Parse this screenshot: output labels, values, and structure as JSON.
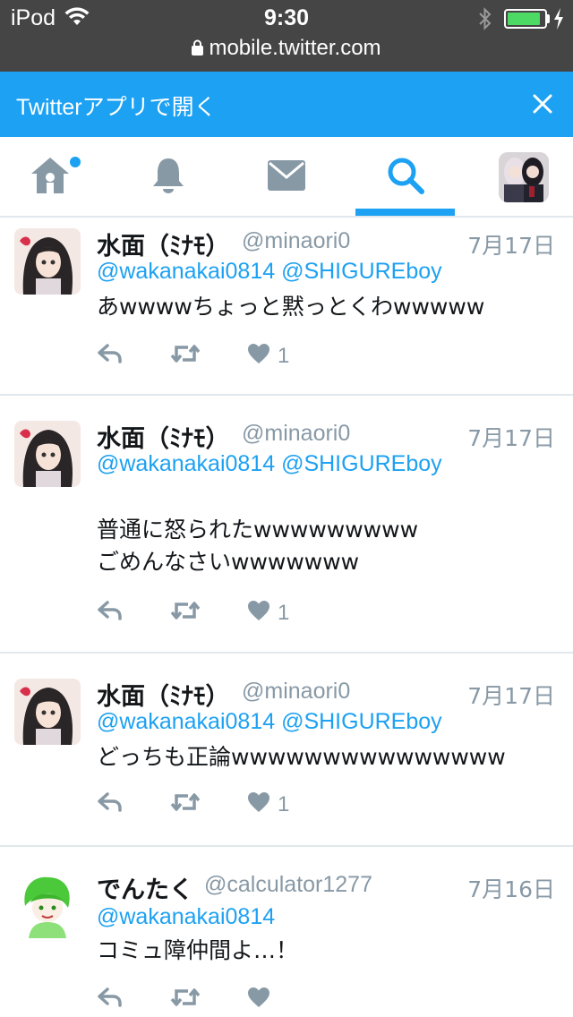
{
  "status_bar": {
    "carrier": "iPod",
    "time": "9:30",
    "url": "mobile.twitter.com",
    "battery_level": 0.9
  },
  "banner": {
    "text": "Twitterアプリで開く"
  },
  "tabs": [
    {
      "name": "home",
      "icon": "home-icon",
      "has_notification_dot": true
    },
    {
      "name": "notifications",
      "icon": "bell-icon"
    },
    {
      "name": "messages",
      "icon": "envelope-icon"
    },
    {
      "name": "search",
      "icon": "search-icon",
      "active": true
    },
    {
      "name": "profile",
      "icon": "avatar"
    }
  ],
  "colors": {
    "accent": "#1da1f2",
    "status_bar": "#454545",
    "muted": "#8899a6",
    "battery": "#4cd964"
  },
  "tweets": [
    {
      "name": "水面（ﾐﾅﾓ）",
      "handle": "@minaori0",
      "date": "7月17日",
      "mentions": [
        "@wakanakai0814",
        "@SHIGUREboy"
      ],
      "body": "あwwwwちょっと黙っとくわwwwww",
      "likes": "1"
    },
    {
      "name": "水面（ﾐﾅﾓ）",
      "handle": "@minaori0",
      "date": "7月17日",
      "mentions": [
        "@wakanakai0814",
        "@SHIGUREboy"
      ],
      "body": "\n普通に怒られたwwwwwwwww\nごめんなさいwwwwwww",
      "likes": "1"
    },
    {
      "name": "水面（ﾐﾅﾓ）",
      "handle": "@minaori0",
      "date": "7月17日",
      "mentions": [
        "@wakanakai0814",
        "@SHIGUREboy"
      ],
      "body": "どっちも正論wwwwwwwwwwwwwww",
      "likes": "1"
    },
    {
      "name": "でんたく",
      "handle": "@calculator1277",
      "date": "7月16日",
      "mentions": [
        "@wakanakai0814"
      ],
      "body": "コミュ障仲間よ…！",
      "likes": ""
    }
  ]
}
